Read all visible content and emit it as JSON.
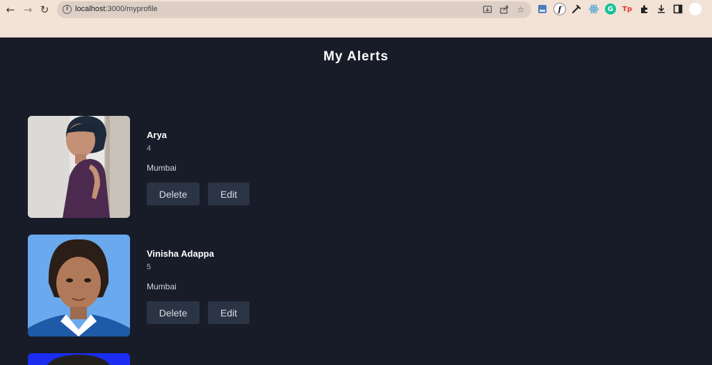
{
  "browser": {
    "back_icon": "←",
    "forward_icon": "→",
    "reload_icon": "↻",
    "url_host": "localhost",
    "url_rest": ":3000/myprofile",
    "info_icon": "i",
    "bookmark_icon": "☆"
  },
  "page": {
    "title": "My Alerts"
  },
  "alerts": [
    {
      "name": "Arya",
      "age": "4",
      "city": "Mumbai",
      "delete_label": "Delete",
      "edit_label": "Edit"
    },
    {
      "name": "Vinisha Adappa",
      "age": "5",
      "city": "Mumbai",
      "delete_label": "Delete",
      "edit_label": "Edit"
    }
  ],
  "colors": {
    "background": "#171c28",
    "button": "#2b3444",
    "chrome": "#f3e2d6"
  }
}
